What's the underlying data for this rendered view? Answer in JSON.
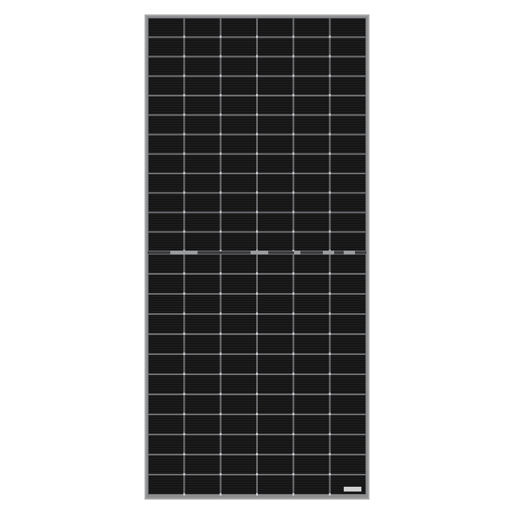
{
  "image": {
    "subject": "solar-panel",
    "cell_layout": {
      "columns": 6,
      "rows_per_half": 12,
      "halves": 2
    },
    "colors": {
      "background": "#ffffff",
      "frame": "#a7a8aa",
      "frame_inner": "#8e8f91",
      "cell": "#151515",
      "cell_line": "#232323",
      "cell_gap": "#6f7073",
      "busbar_dot": "#d8d8d8"
    },
    "label_sticker": "label-sticker"
  }
}
